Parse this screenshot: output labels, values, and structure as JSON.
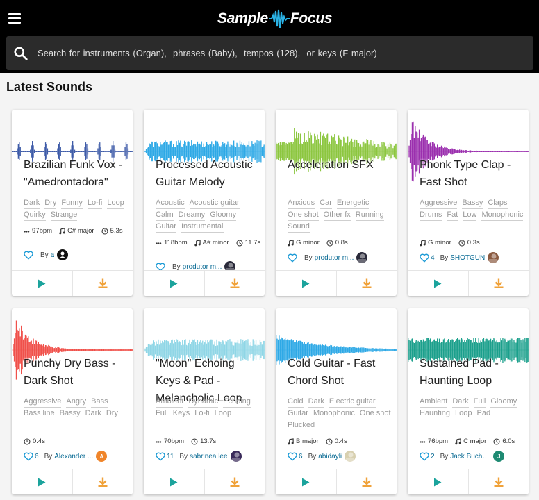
{
  "app": {
    "logo_left": "Sample",
    "logo_right": "Focus"
  },
  "search": {
    "placeholder": "Search for instruments (Organ),  phrases (Baby),  tempos (128),  or keys (F major)"
  },
  "section": {
    "title": "Latest Sounds"
  },
  "colors": {
    "play": "#1ba39c",
    "download": "#f0a23a",
    "link": "#0a6b94",
    "heart": "#1c9bd6"
  },
  "cards": [
    {
      "title": "Brazilian Funk Vox - \"Amedrontadora\"",
      "tags": [
        "Dark",
        "Dry",
        "Funny",
        "Lo-fi",
        "Loop",
        "Quirky",
        "Strange"
      ],
      "meta": [
        {
          "icon": "bpm-icon",
          "text": "97bpm"
        },
        {
          "icon": "note-icon",
          "text": "C# major"
        },
        {
          "icon": "clock-icon",
          "text": "5.3s"
        }
      ],
      "likes": "",
      "by_label": "By",
      "author": "a",
      "wave_color": "#3e5ba8",
      "wave_type": "pulses",
      "avatar_color": "#111111",
      "avatar_letter": "",
      "avatar_icon": "user-icon"
    },
    {
      "title": "Processed Acoustic Guitar Melody",
      "tags": [
        "Acoustic",
        "Acoustic guitar",
        "Calm",
        "Dreamy",
        "Gloomy",
        "Guitar",
        "Instrumental"
      ],
      "meta": [
        {
          "icon": "bpm-icon",
          "text": "118bpm"
        },
        {
          "icon": "note-icon",
          "text": "A# minor"
        },
        {
          "icon": "clock-icon",
          "text": "11.7s"
        }
      ],
      "likes": "",
      "by_label": "By",
      "author": "produtor m...",
      "wave_color": "#2ea9e6",
      "wave_type": "dense",
      "avatar_color": "#2a2a3a",
      "avatar_letter": "",
      "avatar_icon": "photo-icon"
    },
    {
      "title": "Acceleration SFX",
      "tags": [
        "Anxious",
        "Car",
        "Energetic",
        "One shot",
        "Other fx",
        "Running",
        "Sound"
      ],
      "meta": [
        {
          "icon": "note-icon",
          "text": "G minor"
        },
        {
          "icon": "clock-icon",
          "text": "0.8s"
        }
      ],
      "likes": "",
      "by_label": "By",
      "author": "produtor m...",
      "wave_color": "#8cc63f",
      "wave_type": "burst",
      "avatar_color": "#2a2a3a",
      "avatar_letter": "",
      "avatar_icon": "photo-icon"
    },
    {
      "title": "Phonk Type Clap - Fast Shot",
      "tags": [
        "Aggressive",
        "Bassy",
        "Claps",
        "Drums",
        "Fat",
        "Low",
        "Monophonic"
      ],
      "meta": [
        {
          "icon": "note-icon",
          "text": "G minor"
        },
        {
          "icon": "clock-icon",
          "text": "0.3s"
        }
      ],
      "likes": "4",
      "by_label": "By",
      "author": "SHOTGUN",
      "wave_color": "#9b2fae",
      "wave_type": "decay",
      "avatar_color": "#8a5a40",
      "avatar_letter": "",
      "avatar_icon": "photo-icon"
    },
    {
      "title": "Punchy Dry Bass - Dark Shot",
      "tags": [
        "Aggressive",
        "Angry",
        "Bass",
        "Bass line",
        "Bassy",
        "Dark",
        "Dry"
      ],
      "meta": [
        {
          "icon": "clock-icon",
          "text": "0.4s"
        }
      ],
      "likes": "6",
      "by_label": "By",
      "author": "Alexander ...",
      "wave_color": "#f0504a",
      "wave_type": "decay",
      "avatar_color": "#f0852a",
      "avatar_letter": "A",
      "avatar_icon": ""
    },
    {
      "title": "\"Moon\" Echoing Keys & Pad - Melancholic Loop",
      "tags": [
        "Ambient",
        "Dynamic",
        "Echoing",
        "Full",
        "Keys",
        "Lo-fi",
        "Loop"
      ],
      "meta": [
        {
          "icon": "bpm-icon",
          "text": "70bpm"
        },
        {
          "icon": "clock-icon",
          "text": "13.7s"
        }
      ],
      "likes": "11",
      "by_label": "By",
      "author": "sabrinea lee",
      "wave_color": "#8fd6e6",
      "wave_type": "dense",
      "avatar_color": "#3a2a5a",
      "avatar_letter": "",
      "avatar_icon": "photo-icon"
    },
    {
      "title": "Cold Guitar - Fast Chord Shot",
      "tags": [
        "Cold",
        "Dark",
        "Electric guitar",
        "Guitar",
        "Monophonic",
        "One shot",
        "Plucked"
      ],
      "meta": [
        {
          "icon": "note-icon",
          "text": "B major"
        },
        {
          "icon": "clock-icon",
          "text": "0.4s"
        }
      ],
      "likes": "6",
      "by_label": "By",
      "author": "abidayli",
      "wave_color": "#2ea9e6",
      "wave_type": "taper",
      "avatar_color": "#d8d0b0",
      "avatar_letter": "",
      "avatar_icon": "photo-icon"
    },
    {
      "title": "Sustained Pad - Haunting Loop",
      "tags": [
        "Ambient",
        "Dark",
        "Full",
        "Gloomy",
        "Haunting",
        "Loop",
        "Pad"
      ],
      "meta": [
        {
          "icon": "bpm-icon",
          "text": "76bpm"
        },
        {
          "icon": "note-icon",
          "text": "C major"
        },
        {
          "icon": "clock-icon",
          "text": "6.0s"
        }
      ],
      "likes": "2",
      "by_label": "By",
      "author": "Jack Bucho...",
      "wave_color": "#1ba08c",
      "wave_type": "sustain",
      "avatar_color": "#1e8a72",
      "avatar_letter": "J",
      "avatar_icon": ""
    }
  ]
}
